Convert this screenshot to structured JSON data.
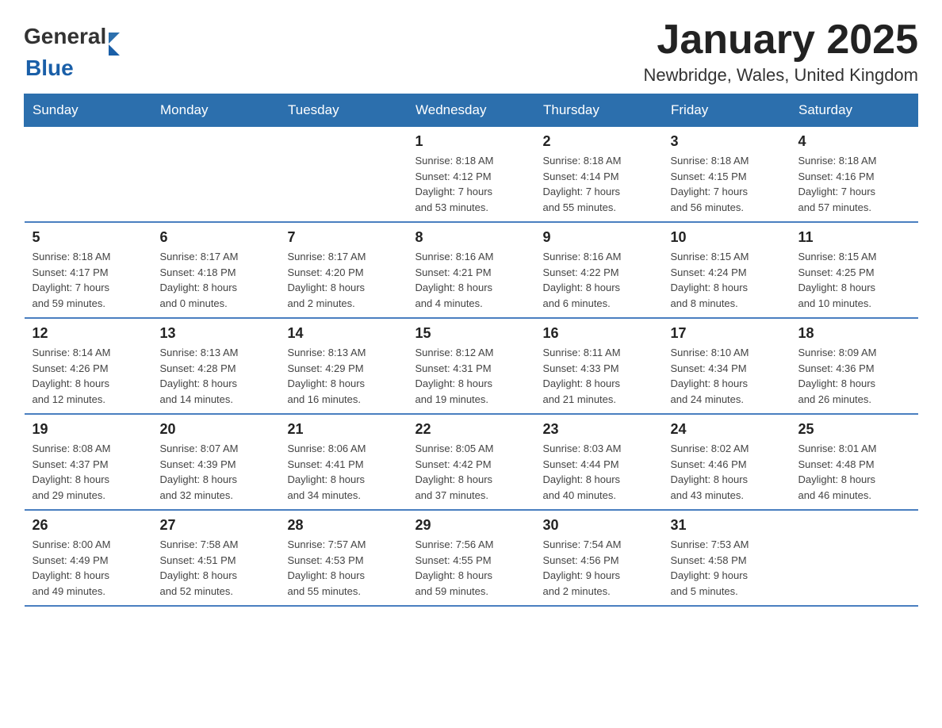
{
  "header": {
    "title": "January 2025",
    "subtitle": "Newbridge, Wales, United Kingdom"
  },
  "logo": {
    "general": "General",
    "blue": "Blue"
  },
  "days_of_week": [
    "Sunday",
    "Monday",
    "Tuesday",
    "Wednesday",
    "Thursday",
    "Friday",
    "Saturday"
  ],
  "weeks": [
    [
      {
        "day": "",
        "info": ""
      },
      {
        "day": "",
        "info": ""
      },
      {
        "day": "",
        "info": ""
      },
      {
        "day": "1",
        "info": "Sunrise: 8:18 AM\nSunset: 4:12 PM\nDaylight: 7 hours\nand 53 minutes."
      },
      {
        "day": "2",
        "info": "Sunrise: 8:18 AM\nSunset: 4:14 PM\nDaylight: 7 hours\nand 55 minutes."
      },
      {
        "day": "3",
        "info": "Sunrise: 8:18 AM\nSunset: 4:15 PM\nDaylight: 7 hours\nand 56 minutes."
      },
      {
        "day": "4",
        "info": "Sunrise: 8:18 AM\nSunset: 4:16 PM\nDaylight: 7 hours\nand 57 minutes."
      }
    ],
    [
      {
        "day": "5",
        "info": "Sunrise: 8:18 AM\nSunset: 4:17 PM\nDaylight: 7 hours\nand 59 minutes."
      },
      {
        "day": "6",
        "info": "Sunrise: 8:17 AM\nSunset: 4:18 PM\nDaylight: 8 hours\nand 0 minutes."
      },
      {
        "day": "7",
        "info": "Sunrise: 8:17 AM\nSunset: 4:20 PM\nDaylight: 8 hours\nand 2 minutes."
      },
      {
        "day": "8",
        "info": "Sunrise: 8:16 AM\nSunset: 4:21 PM\nDaylight: 8 hours\nand 4 minutes."
      },
      {
        "day": "9",
        "info": "Sunrise: 8:16 AM\nSunset: 4:22 PM\nDaylight: 8 hours\nand 6 minutes."
      },
      {
        "day": "10",
        "info": "Sunrise: 8:15 AM\nSunset: 4:24 PM\nDaylight: 8 hours\nand 8 minutes."
      },
      {
        "day": "11",
        "info": "Sunrise: 8:15 AM\nSunset: 4:25 PM\nDaylight: 8 hours\nand 10 minutes."
      }
    ],
    [
      {
        "day": "12",
        "info": "Sunrise: 8:14 AM\nSunset: 4:26 PM\nDaylight: 8 hours\nand 12 minutes."
      },
      {
        "day": "13",
        "info": "Sunrise: 8:13 AM\nSunset: 4:28 PM\nDaylight: 8 hours\nand 14 minutes."
      },
      {
        "day": "14",
        "info": "Sunrise: 8:13 AM\nSunset: 4:29 PM\nDaylight: 8 hours\nand 16 minutes."
      },
      {
        "day": "15",
        "info": "Sunrise: 8:12 AM\nSunset: 4:31 PM\nDaylight: 8 hours\nand 19 minutes."
      },
      {
        "day": "16",
        "info": "Sunrise: 8:11 AM\nSunset: 4:33 PM\nDaylight: 8 hours\nand 21 minutes."
      },
      {
        "day": "17",
        "info": "Sunrise: 8:10 AM\nSunset: 4:34 PM\nDaylight: 8 hours\nand 24 minutes."
      },
      {
        "day": "18",
        "info": "Sunrise: 8:09 AM\nSunset: 4:36 PM\nDaylight: 8 hours\nand 26 minutes."
      }
    ],
    [
      {
        "day": "19",
        "info": "Sunrise: 8:08 AM\nSunset: 4:37 PM\nDaylight: 8 hours\nand 29 minutes."
      },
      {
        "day": "20",
        "info": "Sunrise: 8:07 AM\nSunset: 4:39 PM\nDaylight: 8 hours\nand 32 minutes."
      },
      {
        "day": "21",
        "info": "Sunrise: 8:06 AM\nSunset: 4:41 PM\nDaylight: 8 hours\nand 34 minutes."
      },
      {
        "day": "22",
        "info": "Sunrise: 8:05 AM\nSunset: 4:42 PM\nDaylight: 8 hours\nand 37 minutes."
      },
      {
        "day": "23",
        "info": "Sunrise: 8:03 AM\nSunset: 4:44 PM\nDaylight: 8 hours\nand 40 minutes."
      },
      {
        "day": "24",
        "info": "Sunrise: 8:02 AM\nSunset: 4:46 PM\nDaylight: 8 hours\nand 43 minutes."
      },
      {
        "day": "25",
        "info": "Sunrise: 8:01 AM\nSunset: 4:48 PM\nDaylight: 8 hours\nand 46 minutes."
      }
    ],
    [
      {
        "day": "26",
        "info": "Sunrise: 8:00 AM\nSunset: 4:49 PM\nDaylight: 8 hours\nand 49 minutes."
      },
      {
        "day": "27",
        "info": "Sunrise: 7:58 AM\nSunset: 4:51 PM\nDaylight: 8 hours\nand 52 minutes."
      },
      {
        "day": "28",
        "info": "Sunrise: 7:57 AM\nSunset: 4:53 PM\nDaylight: 8 hours\nand 55 minutes."
      },
      {
        "day": "29",
        "info": "Sunrise: 7:56 AM\nSunset: 4:55 PM\nDaylight: 8 hours\nand 59 minutes."
      },
      {
        "day": "30",
        "info": "Sunrise: 7:54 AM\nSunset: 4:56 PM\nDaylight: 9 hours\nand 2 minutes."
      },
      {
        "day": "31",
        "info": "Sunrise: 7:53 AM\nSunset: 4:58 PM\nDaylight: 9 hours\nand 5 minutes."
      },
      {
        "day": "",
        "info": ""
      }
    ]
  ],
  "colors": {
    "header_bg": "#2c6fad",
    "header_text": "#ffffff",
    "border": "#4a7fc0"
  }
}
